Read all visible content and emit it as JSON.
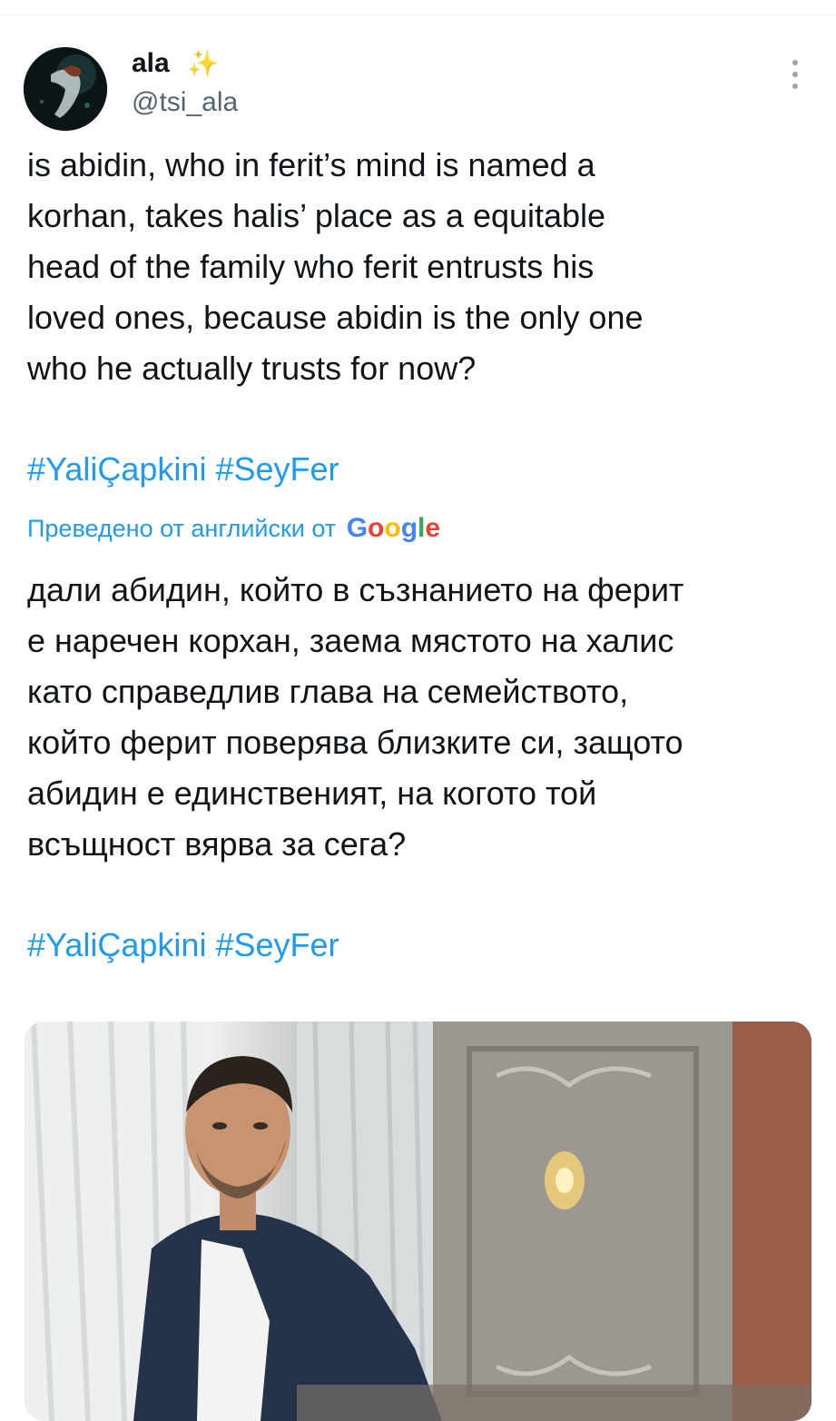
{
  "tweet": {
    "author": {
      "name": "ala",
      "name_emoji": "✨",
      "handle": "@tsi_ala"
    },
    "text": "is abidin, who in ferit’s mind is named a\nkorhan, takes halis’ place as a equitable\nhead of the family who ferit entrusts his\nloved ones, because abidin is the only one\nwho he actually trusts for now?",
    "hashtags": [
      "#YaliÇapkini",
      "#SeyFer"
    ],
    "translation": {
      "label": "Преведено от английски от",
      "provider_letters": [
        "G",
        "o",
        "o",
        "g",
        "l",
        "e"
      ],
      "text": "дали абидин, който в съзнанието на ферит\nе наречен корхан, заема мястото на халис\nкато справедлив глава на семейството,\nкойто ферит поверява близките си, защото\nабидин е единственият, на когото той\nвсъщност вярва за сега?",
      "hashtags": [
        "#YaliÇapkini",
        "#SeyFer"
      ]
    }
  },
  "colors": {
    "text": "#0f1419",
    "secondary": "#536471",
    "link": "#1d9bf0",
    "divider": "#eff3f4"
  },
  "icons": {
    "more": "more-vertical-icon",
    "sparkle": "sparkles-icon"
  }
}
